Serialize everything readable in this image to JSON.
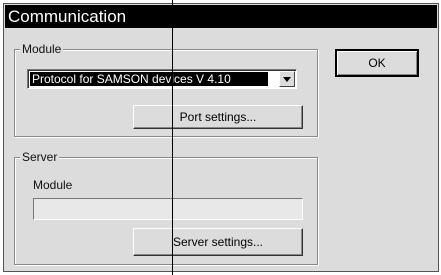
{
  "window": {
    "title": "Communication"
  },
  "module_group": {
    "legend": "Module",
    "protocol_select": {
      "value": "Protocol for SAMSON devices V 4.10"
    },
    "port_settings_label": "Port settings..."
  },
  "server_group": {
    "legend": "Server",
    "module_label": "Module",
    "module_value": "",
    "server_settings_label": "Server settings..."
  },
  "ok_label": "OK"
}
